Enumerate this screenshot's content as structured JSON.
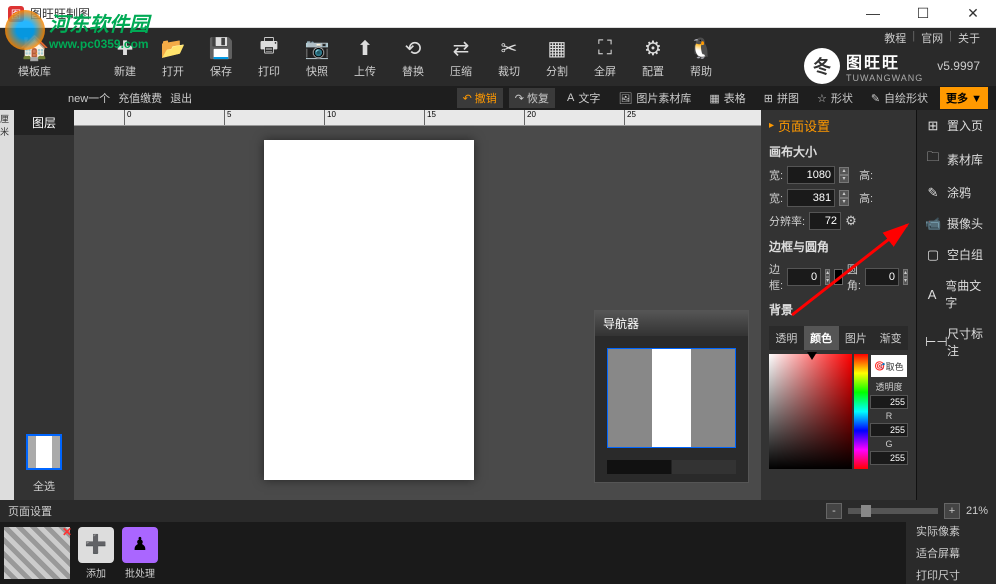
{
  "window": {
    "title": "图旺旺制图"
  },
  "watermark": {
    "cn": "河东软件园",
    "url": "www.pc0359.com"
  },
  "toolbar": {
    "template": "模板库",
    "items": [
      {
        "icon": "✚",
        "label": "新建"
      },
      {
        "icon": "📂",
        "label": "打开"
      },
      {
        "icon": "💾",
        "label": "保存"
      },
      {
        "icon": "🖶",
        "label": "打印"
      },
      {
        "icon": "📷",
        "label": "快照"
      },
      {
        "icon": "⬆",
        "label": "上传"
      },
      {
        "icon": "⟲",
        "label": "替换"
      },
      {
        "icon": "⇄",
        "label": "压缩"
      },
      {
        "icon": "✂",
        "label": "裁切"
      },
      {
        "icon": "▦",
        "label": "分割"
      },
      {
        "icon": "⛶",
        "label": "全屏"
      },
      {
        "icon": "⚙",
        "label": "配置"
      },
      {
        "icon": "🐧",
        "label": "帮助"
      }
    ]
  },
  "brand": {
    "links": {
      "tutorial": "教程",
      "official": "官网",
      "about": "关于"
    },
    "cn": "图旺旺",
    "en": "TUWANGWANG",
    "version": "v5.9997",
    "logo": "冬"
  },
  "breadcrumb": {
    "item1": "new一个",
    "item2": "充值缴费",
    "item3": "退出"
  },
  "subactions": {
    "undo": "撤销",
    "redo": "恢复",
    "text": "文字",
    "imglib": "图片素材库",
    "table": "表格",
    "puzzle": "拼图",
    "shape": "形状",
    "freeshape": "自绘形状",
    "more": "更多 ▼"
  },
  "ruler_unit": "厘米",
  "layers": {
    "header": "图层",
    "selectall": "全选"
  },
  "navigator": {
    "title": "导航器"
  },
  "pagepanel": {
    "header": "页面设置",
    "canvassize": "画布大小",
    "width_label": "宽:",
    "height_label": "高:",
    "width1": "1080",
    "height1": "",
    "width2": "381",
    "height2": "",
    "resolution_label": "分辨率:",
    "resolution": "72",
    "borderradius": "边框与圆角",
    "border_label": "边框:",
    "border": "0",
    "radius_label": "圆角:",
    "radius": "0",
    "background": "背景",
    "tabs": {
      "transparent": "透明",
      "color": "颜色",
      "image": "图片",
      "gradient": "渐变"
    },
    "picker": {
      "eyedrop": "取色",
      "opacity_label": "透明度",
      "opacity": "255",
      "r_label": "R",
      "r": "255",
      "g_label": "G",
      "g": "255"
    }
  },
  "sidemenu": {
    "items": [
      {
        "icon": "⊞",
        "label": "置入页"
      },
      {
        "icon": "🗀",
        "label": "素材库"
      },
      {
        "icon": "✎",
        "label": "涂鸦"
      },
      {
        "icon": "📹",
        "label": "摄像头"
      },
      {
        "icon": "▢",
        "label": "空白组"
      },
      {
        "icon": "A",
        "label": "弯曲文字"
      },
      {
        "icon": "⊢⊣",
        "label": "尺寸标注"
      }
    ]
  },
  "bottombar": {
    "label": "页面设置",
    "zoom": "21%"
  },
  "footer": {
    "add": "添加",
    "batch": "批处理",
    "menu": {
      "actual": "实际像素",
      "fit": "适合屏幕",
      "printsize": "打印尺寸"
    }
  }
}
